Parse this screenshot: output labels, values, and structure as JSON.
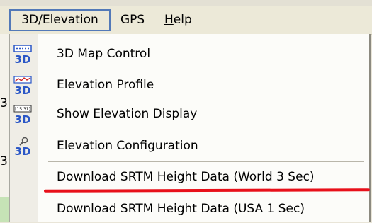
{
  "background": {
    "left_fragments": [
      "3",
      "3"
    ]
  },
  "menubar": {
    "items": [
      {
        "label": "3D/Elevation",
        "open": true
      },
      {
        "label": "GPS"
      },
      {
        "label": "Help",
        "underline_char": "H",
        "rest": "elp"
      }
    ]
  },
  "dropdown": {
    "items": [
      {
        "label": "3D Map Control",
        "icon": "3d-map-control-icon"
      },
      {
        "label": "Elevation Profile",
        "icon": "elevation-profile-icon"
      },
      {
        "label": "Show Elevation Display",
        "icon": "elevation-display-icon"
      },
      {
        "label": "Elevation Configuration",
        "icon": "elevation-configuration-icon"
      },
      {
        "label": "Download SRTM Height Data (World 3 Sec)"
      },
      {
        "label": "Download SRTM Height Data (USA 1 Sec)"
      }
    ],
    "icon_badge_text": "3D",
    "display_icon_text": "[15.31]",
    "highlight_color": "#e8101a",
    "accent_color": "#2a56c6"
  }
}
